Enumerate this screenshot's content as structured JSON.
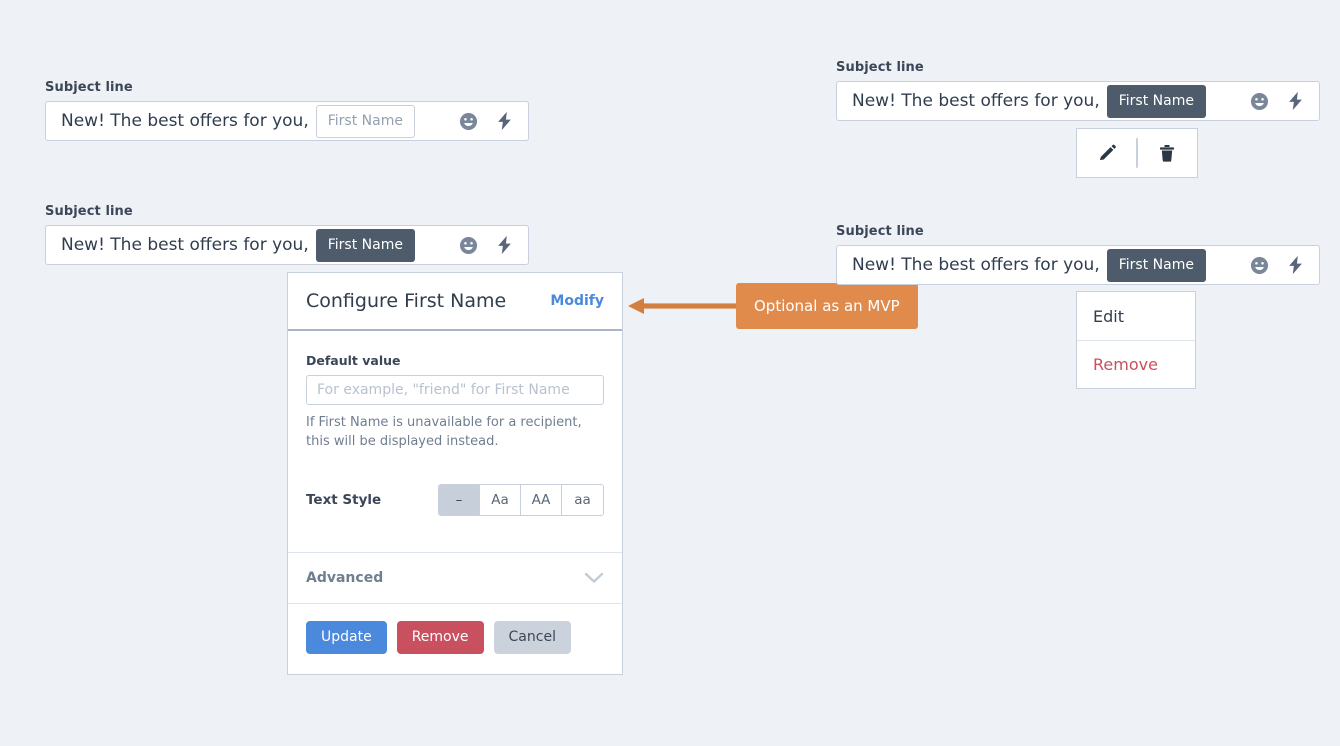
{
  "colors": {
    "background": "#eef1f5",
    "accent_blue": "#4a89dc",
    "danger_red": "#c8505f",
    "chip_slate": "#4e5b6b",
    "callout_orange": "#e08b4c",
    "border": "#c7d0dc"
  },
  "subject_fields": [
    {
      "label": "Subject line",
      "text": "New! The best offers for you,",
      "chip": "First Name",
      "chip_style": "outline",
      "icons": [
        "emoji-icon",
        "personalization-bolt-icon"
      ]
    },
    {
      "label": "Subject line",
      "text": "New! The best offers for you,",
      "chip": "First Name",
      "chip_style": "solid",
      "icons": [
        "emoji-icon",
        "personalization-bolt-icon"
      ]
    },
    {
      "label": "Subject line",
      "text": "New! The best offers for you,",
      "chip": "First Name",
      "chip_style": "solid",
      "icons": [
        "emoji-icon",
        "personalization-bolt-icon"
      ]
    },
    {
      "label": "Subject line",
      "text": "New! The best offers for you,",
      "chip": "First Name",
      "chip_style": "solid",
      "icons": [
        "emoji-icon",
        "personalization-bolt-icon"
      ]
    }
  ],
  "icon_toolbar": {
    "edit_icon": "pencil-icon",
    "delete_icon": "trash-icon"
  },
  "context_menu": {
    "items": [
      {
        "label": "Edit",
        "tone": "default"
      },
      {
        "label": "Remove",
        "tone": "danger"
      }
    ]
  },
  "configure_panel": {
    "title": "Configure First Name",
    "modify_label": "Modify",
    "default_value": {
      "label": "Default value",
      "value": "",
      "placeholder": "For example, \"friend\" for First Name"
    },
    "help_text": "If First Name is unavailable for a recipient, this will be displayed instead.",
    "text_style": {
      "label": "Text Style",
      "options": [
        "–",
        "Aa",
        "AA",
        "aa"
      ],
      "selected_index": 0
    },
    "advanced": {
      "label": "Advanced",
      "chevron": "chevron-down-icon"
    },
    "buttons": {
      "update": "Update",
      "remove": "Remove",
      "cancel": "Cancel"
    }
  },
  "annotation": {
    "text": "Optional as an MVP"
  }
}
